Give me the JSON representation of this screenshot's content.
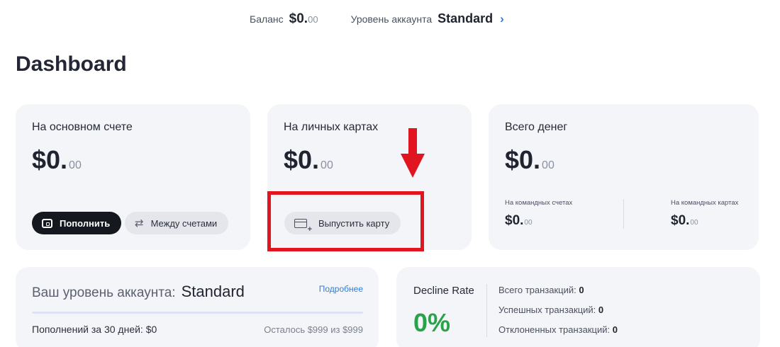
{
  "topbar": {
    "balance_label": "Баланс",
    "balance_main": "$0.",
    "balance_cents": "00",
    "level_label": "Уровень аккаунта",
    "level_value": "Standard",
    "level_chevron": "›"
  },
  "page": {
    "title": "Dashboard"
  },
  "cards": {
    "main_account": {
      "title": "На основном счете",
      "amount_main": "$0.",
      "amount_cents": "00",
      "topup_label": "Пополнить",
      "between_label": "Между счетами"
    },
    "personal_cards": {
      "title": "На личных картах",
      "amount_main": "$0.",
      "amount_cents": "00",
      "issue_label": "Выпустить карту"
    },
    "total": {
      "title": "Всего денег",
      "amount_main": "$0.",
      "amount_cents": "00",
      "team_accounts_label": "На командных счетах",
      "team_accounts_main": "$0.",
      "team_accounts_cents": "00",
      "team_cards_label": "На командных картах",
      "team_cards_main": "$0.",
      "team_cards_cents": "00"
    }
  },
  "account_level": {
    "label": "Ваш уровень аккаунта:",
    "value": "Standard",
    "more_link": "Подробнее",
    "topups_label": "Пополнений за 30 дней: $0",
    "remaining_label": "Осталось $999 из $999",
    "progress": 0
  },
  "decline": {
    "label": "Decline Rate",
    "value": "0%",
    "total_label": "Всего транзакций:",
    "total_value": "0",
    "success_label": "Успешных транзакций:",
    "success_value": "0",
    "declined_label": "Отклоненных транзакций:",
    "declined_value": "0"
  },
  "colors": {
    "accent": "#2f7dd8",
    "success": "#28a34a",
    "highlight": "#e0151f",
    "dark_button": "#16181f",
    "card_bg": "#f4f5f9"
  },
  "icons": {
    "topup": "wallet-icon",
    "between": "swap-arrows-icon",
    "issue": "card-plus-icon",
    "annotation": "arrow-down-icon"
  }
}
